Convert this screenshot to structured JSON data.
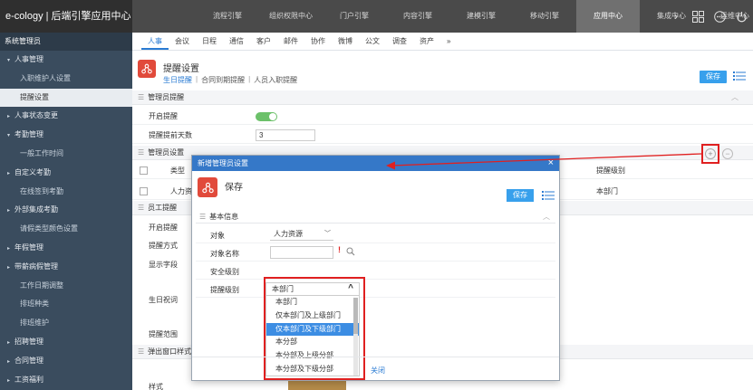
{
  "brand": "e-cology | 后端引擎应用中心",
  "topnav": [
    "",
    "流程引擎",
    "组织权限中心",
    "门户引擎",
    "内容引擎",
    "建模引擎",
    "移动引擎",
    "应用中心",
    "集成中心",
    "运维中心"
  ],
  "topnav_active_index": 7,
  "sidebar": {
    "title": "系统管理员",
    "items": [
      {
        "label": "人事管理",
        "level": 1,
        "caret": "▾"
      },
      {
        "label": "入职维护人设置",
        "level": 2
      },
      {
        "label": "提醒设置",
        "level": 2,
        "active": true
      },
      {
        "label": "人事状态变更",
        "level": 1,
        "caret": "▸"
      },
      {
        "label": "考勤管理",
        "level": 1,
        "caret": "▾"
      },
      {
        "label": "一般工作时间",
        "level": 2
      },
      {
        "label": "自定义考勤",
        "level": 1,
        "caret": "▸"
      },
      {
        "label": "在线签到考勤",
        "level": 2
      },
      {
        "label": "外部集成考勤",
        "level": 1,
        "caret": "▸"
      },
      {
        "label": "请假类型颜色设置",
        "level": 2
      },
      {
        "label": "年假管理",
        "level": 1,
        "caret": "▸"
      },
      {
        "label": "带薪病假管理",
        "level": 1,
        "caret": "▸"
      },
      {
        "label": "工作日期调整",
        "level": 2
      },
      {
        "label": "排班种类",
        "level": 2
      },
      {
        "label": "排班维护",
        "level": 2
      },
      {
        "label": "招聘管理",
        "level": 1,
        "caret": "▸"
      },
      {
        "label": "合同管理",
        "level": 1,
        "caret": "▸"
      },
      {
        "label": "工资福利",
        "level": 1,
        "caret": "▸"
      }
    ]
  },
  "subtabs": [
    "人事",
    "会议",
    "日程",
    "通信",
    "客户",
    "邮件",
    "协作",
    "微博",
    "公文",
    "调查",
    "资产",
    "»"
  ],
  "page": {
    "title": "提醒设置",
    "sublinks": [
      "生日提醒",
      "合同到期提醒",
      "人员入职提醒"
    ],
    "save": "保存"
  },
  "sections": {
    "admin_remind": "管理员提醒",
    "enable_label": "开启提醒",
    "advance_days_label": "提醒提前天数",
    "advance_days_value": "3",
    "admin_settings": "管理员设置",
    "col_type": "类型",
    "col_level": "提醒级别",
    "row_type": "人力资",
    "row_level": "本部门",
    "employee_remind": "员工提醒",
    "labels": [
      "开启提醒",
      "提醒方式",
      "显示字段",
      "生日祝词",
      "提醒范围"
    ],
    "popup_style": "弹出窗口样式",
    "style_label": "样式"
  },
  "modal": {
    "title": "新增管理员设置",
    "heading": "保存",
    "save": "保存",
    "section": "基本信息",
    "object_label": "对象",
    "object_value": "人力资源",
    "object_name_label": "对象名称",
    "security_label": "安全级别",
    "level_label": "提醒级别",
    "level_selected": "本部门",
    "options": [
      "本部门",
      "仅本部门及上级部门",
      "仅本部门及下级部门",
      "本分部",
      "本分部及上级分部",
      "本分部及下级分部"
    ],
    "highlighted_option": 2,
    "close": "关闭"
  },
  "colors": {
    "accent": "#38a0ec",
    "header": "#3578c8",
    "sidebar": "#3a4c5e",
    "annotation": "#e02020"
  }
}
